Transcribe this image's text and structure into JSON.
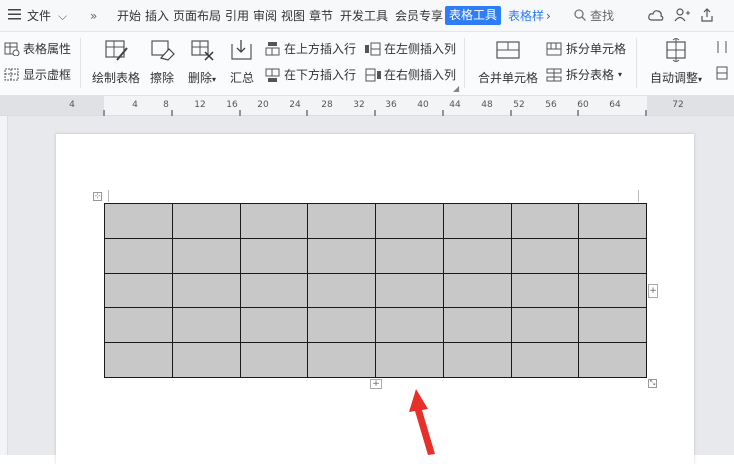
{
  "menubar": {
    "file": "文件",
    "tabs": [
      "开始",
      "插入",
      "页面布局",
      "引用",
      "审阅",
      "视图",
      "章节",
      "开发工具",
      "会员专享"
    ],
    "active_tab": "表格工具",
    "next_tab": "表格样",
    "search": "查找",
    "colors": {
      "active": "#2e7cf6"
    }
  },
  "ribbon": {
    "table_props": "表格属性",
    "show_grid": "显示虚框",
    "draw_table": "绘制表格",
    "erase": "擦除",
    "delete": "删除",
    "summary": "汇总",
    "insert_above": "在上方插入行",
    "insert_below": "在下方插入行",
    "insert_left": "在左侧插入列",
    "insert_right": "在右侧插入列",
    "merge_cells": "合并单元格",
    "split_cells": "拆分单元格",
    "split_table": "拆分表格",
    "auto_fit": "自动调整"
  },
  "ruler": {
    "ticks": [
      "4",
      "4",
      "8",
      "12",
      "16",
      "20",
      "24",
      "28",
      "32",
      "36",
      "40",
      "44",
      "48",
      "52",
      "56",
      "60",
      "64",
      "72"
    ]
  },
  "table": {
    "rows": 5,
    "cols": 8,
    "cell_color": "#c8c8c8",
    "add_row_symbol": "+",
    "add_col_symbol": "+"
  },
  "annotation": {
    "arrow_color": "#e8302a"
  }
}
